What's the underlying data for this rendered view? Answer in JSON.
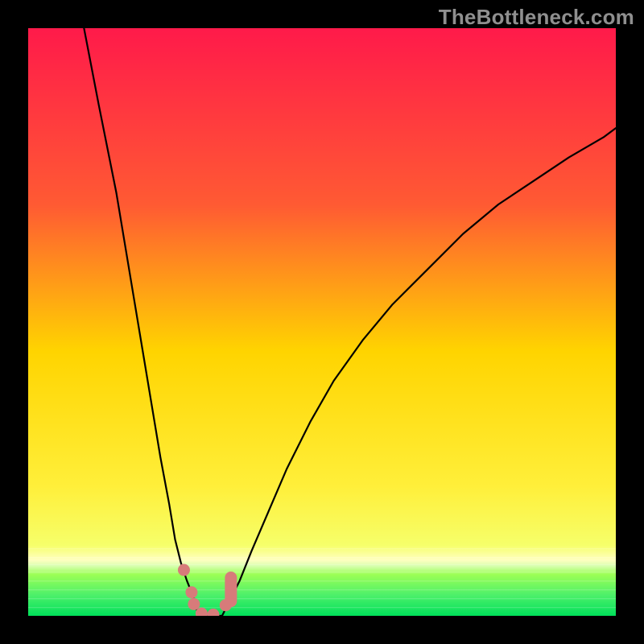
{
  "watermark": "TheBottleneck.com",
  "colors": {
    "frame": "#000000",
    "grad_top": "#ff1a4a",
    "grad_mid1": "#ff6a2a",
    "grad_mid2": "#ffd400",
    "grad_low": "#f6ff6a",
    "grad_green1": "#9bff55",
    "grad_green2": "#00e05a",
    "curve": "#000000",
    "marker": "#d77b7a"
  },
  "chart_data": {
    "type": "line",
    "title": "",
    "xlabel": "",
    "ylabel": "",
    "xlim": [
      0,
      1
    ],
    "ylim": [
      0,
      100
    ],
    "series": [
      {
        "name": "left-branch",
        "x": [
          0.095,
          0.12,
          0.15,
          0.17,
          0.19,
          0.21,
          0.225,
          0.24,
          0.25,
          0.26,
          0.27,
          0.28,
          0.285,
          0.29
        ],
        "values": [
          100,
          87,
          72,
          60,
          48,
          36,
          27,
          19,
          13,
          9,
          6,
          3.5,
          1.7,
          0
        ]
      },
      {
        "name": "right-branch",
        "x": [
          0.33,
          0.34,
          0.36,
          0.38,
          0.41,
          0.44,
          0.48,
          0.52,
          0.57,
          0.62,
          0.68,
          0.74,
          0.8,
          0.86,
          0.92,
          0.98,
          1.0
        ],
        "values": [
          0,
          2,
          6,
          11,
          18,
          25,
          33,
          40,
          47,
          53,
          59,
          65,
          70,
          74,
          78,
          81.5,
          83
        ]
      }
    ],
    "flat_bottom": {
      "x": [
        0.29,
        0.33
      ],
      "y": 0
    },
    "markers": {
      "round": [
        {
          "x": 0.265,
          "y": 7.8
        },
        {
          "x": 0.278,
          "y": 4.0
        },
        {
          "x": 0.282,
          "y": 2.0
        },
        {
          "x": 0.295,
          "y": 0.4
        },
        {
          "x": 0.315,
          "y": 0.2
        },
        {
          "x": 0.336,
          "y": 1.8
        }
      ],
      "pill": [
        {
          "x": 0.345,
          "y_top": 6.5,
          "y_bot": 2.5
        }
      ]
    }
  }
}
